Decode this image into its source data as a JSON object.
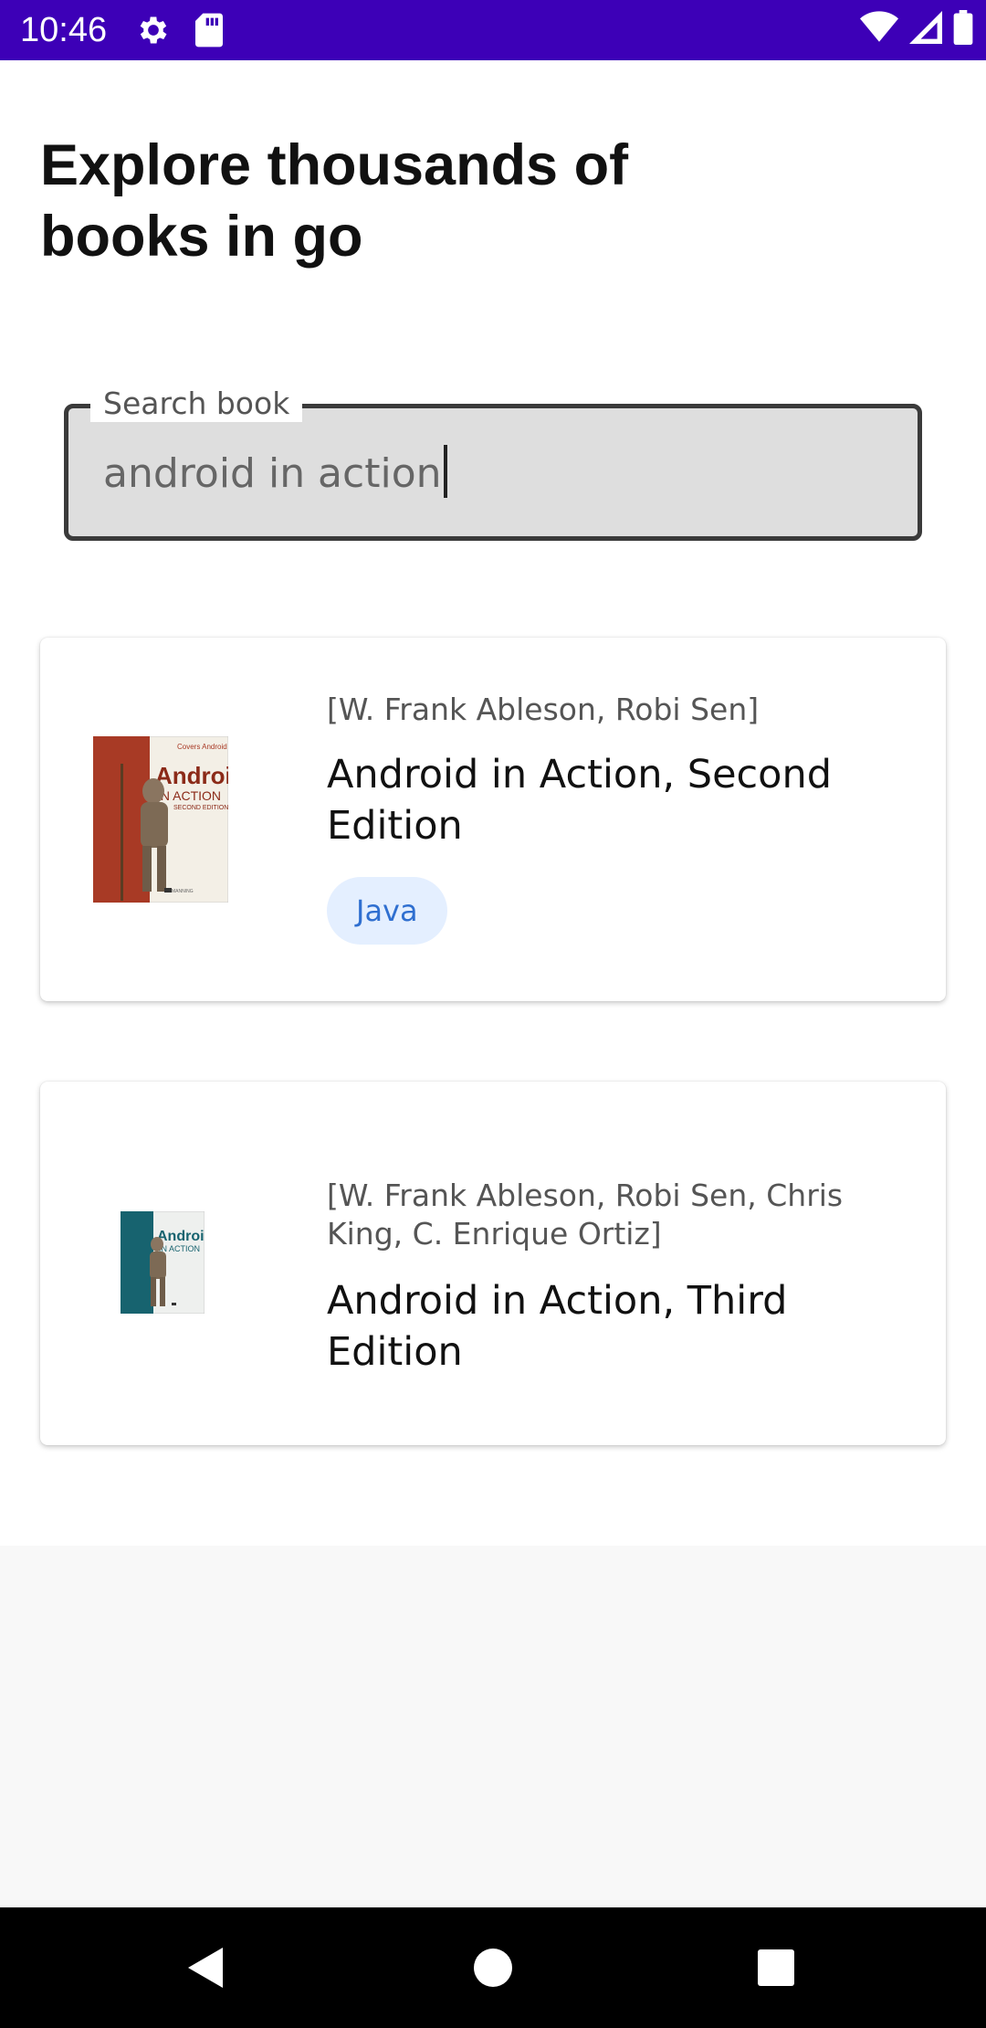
{
  "status_bar": {
    "time": "10:46",
    "icons_left": [
      "gear-icon",
      "sd-card-icon"
    ],
    "icons_right": [
      "wifi-icon",
      "cell-signal-icon",
      "battery-icon"
    ],
    "color": "#3d00b7"
  },
  "header": {
    "title": "Explore thousands of books in go"
  },
  "search": {
    "label": "Search book",
    "value": "android in action"
  },
  "books": [
    {
      "authors": "[W. Frank Ableson, Robi Sen]",
      "title": "Android in Action, Second Edition",
      "tag": "Java",
      "cover_icon": "book-cover-android-in-action-2nd"
    },
    {
      "authors": "[W. Frank Ableson, Robi Sen, Chris King, C. Enrique Ortiz]",
      "title": "Android in Action, Third Edition",
      "cover_icon": "book-cover-android-in-action-3rd"
    }
  ],
  "nav_bar": {
    "buttons": [
      "back-icon",
      "home-icon",
      "recents-icon"
    ]
  },
  "colors": {
    "chip_bg": "#e4efff",
    "chip_text": "#2f6fd0",
    "search_bg": "#dedede"
  }
}
